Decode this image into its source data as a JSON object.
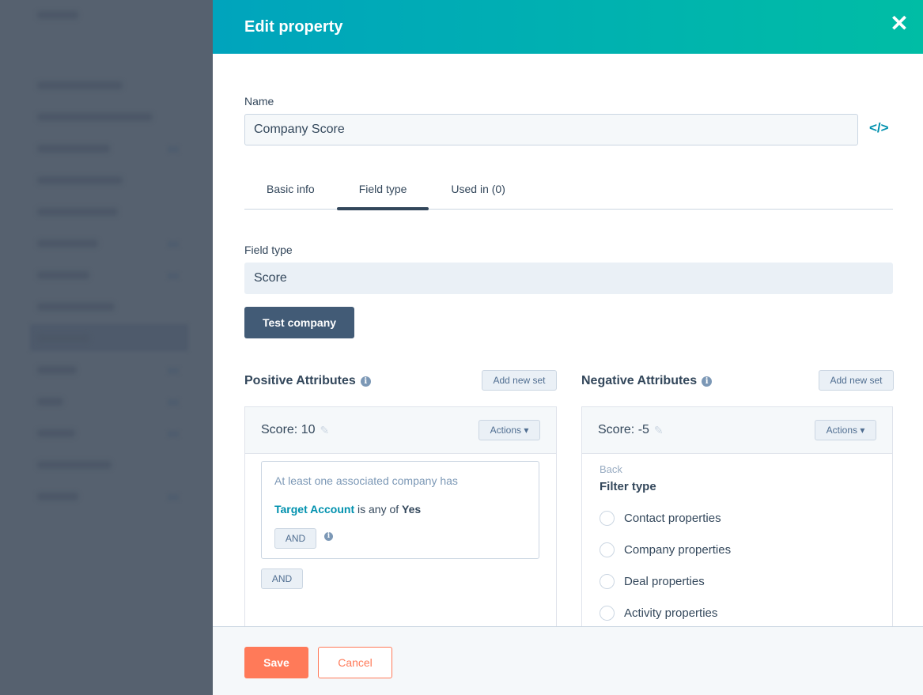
{
  "panel": {
    "title": "Edit property",
    "close_icon": "close-icon"
  },
  "name_field": {
    "label": "Name",
    "value": "Company Score",
    "code_icon": "code-icon"
  },
  "tabs": [
    {
      "label": "Basic info"
    },
    {
      "label": "Field type",
      "active": true
    },
    {
      "label": "Used in (0)"
    }
  ],
  "field_type": {
    "label": "Field type",
    "value": "Score"
  },
  "test_button": "Test company",
  "positive": {
    "title": "Positive Attributes",
    "add_label": "Add new set",
    "score": "Score: 10",
    "actions": "Actions",
    "condition_intro": "At least one associated company has",
    "condition_prop": "Target Account",
    "condition_op": " is any of ",
    "condition_val": "Yes",
    "and_inner": "AND",
    "and_outer": "AND"
  },
  "negative": {
    "title": "Negative Attributes",
    "add_label": "Add new set",
    "score": "Score: -5",
    "actions": "Actions",
    "back": "Back",
    "filter_title": "Filter type",
    "options": [
      "Contact properties",
      "Company properties",
      "Deal properties",
      "Activity properties"
    ]
  },
  "footer": {
    "save": "Save",
    "cancel": "Cancel"
  },
  "colors": {
    "header_start": "#00a4bd",
    "header_end": "#00bda5",
    "save": "#ff7a59",
    "link": "#0091ae",
    "dark_button": "#425b76"
  }
}
